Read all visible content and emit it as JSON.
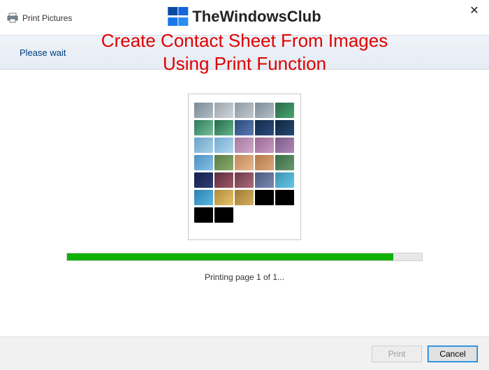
{
  "window": {
    "title": "Print Pictures",
    "close_glyph": "✕"
  },
  "brand": {
    "name": "TheWindowsClub",
    "colors": [
      "#0a4aa3",
      "#1565d8",
      "#1976e8",
      "#2a8cf0"
    ]
  },
  "overlay": {
    "line1": "Create Contact Sheet From Images",
    "line2": "Using Print Function"
  },
  "instruction": {
    "text": "Please wait"
  },
  "preview": {
    "rows": [
      [
        "linear-gradient(135deg,#7a8a95,#b0bcc4)",
        "linear-gradient(135deg,#9aa3ab,#cfd5da)",
        "linear-gradient(135deg,#8b99a3,#c0c8ce)",
        "linear-gradient(135deg,#7c8c97,#b3bec6)",
        "linear-gradient(135deg,#2a6a4a,#4aa372)"
      ],
      [
        "linear-gradient(135deg,#2a7a5a,#7ac09a)",
        "linear-gradient(135deg,#1f6a4a,#6ab58c)",
        "linear-gradient(135deg,#2a4a7a,#5a7ab5)",
        "linear-gradient(135deg,#14294a,#2d4d7e)",
        "linear-gradient(135deg,#0f2540,#254a74)"
      ],
      [
        "linear-gradient(135deg,#6ba3c7,#a9d0e8)",
        "linear-gradient(135deg,#73abd0,#b2d6ec)",
        "linear-gradient(135deg,#a47aa0,#d0a8c8)",
        "linear-gradient(135deg,#9a6a95,#c89ac0)",
        "linear-gradient(135deg,#7a5a88,#b08ab8)"
      ],
      [
        "linear-gradient(135deg,#4a90c0,#8ac0e8)",
        "linear-gradient(135deg,#5a7a4a,#8aae6a)",
        "linear-gradient(135deg,#c0885a,#e8b88a)",
        "linear-gradient(135deg,#b3784a,#dda878)",
        "linear-gradient(135deg,#3a6a4a,#6a9a6a)"
      ],
      [
        "linear-gradient(135deg,#14204a,#2d3c74)",
        "linear-gradient(135deg,#5a2a3a,#a05a6a)",
        "linear-gradient(135deg,#6a3a4a,#b06a7a)",
        "linear-gradient(135deg,#4a5a7a,#7a8ab5)",
        "linear-gradient(135deg,#3a90b0,#6ac8e8)"
      ],
      [
        "linear-gradient(135deg,#2a80b0,#5ab8e0)",
        "linear-gradient(135deg,#b0883a,#e8c66a)",
        "linear-gradient(135deg,#a07a33,#d4b060)",
        "#000000",
        "#000000"
      ],
      [
        "#000000",
        "#000000"
      ]
    ]
  },
  "progress": {
    "percent": 92,
    "status": "Printing page 1 of 1..."
  },
  "footer": {
    "print_label": "Print",
    "cancel_label": "Cancel"
  }
}
